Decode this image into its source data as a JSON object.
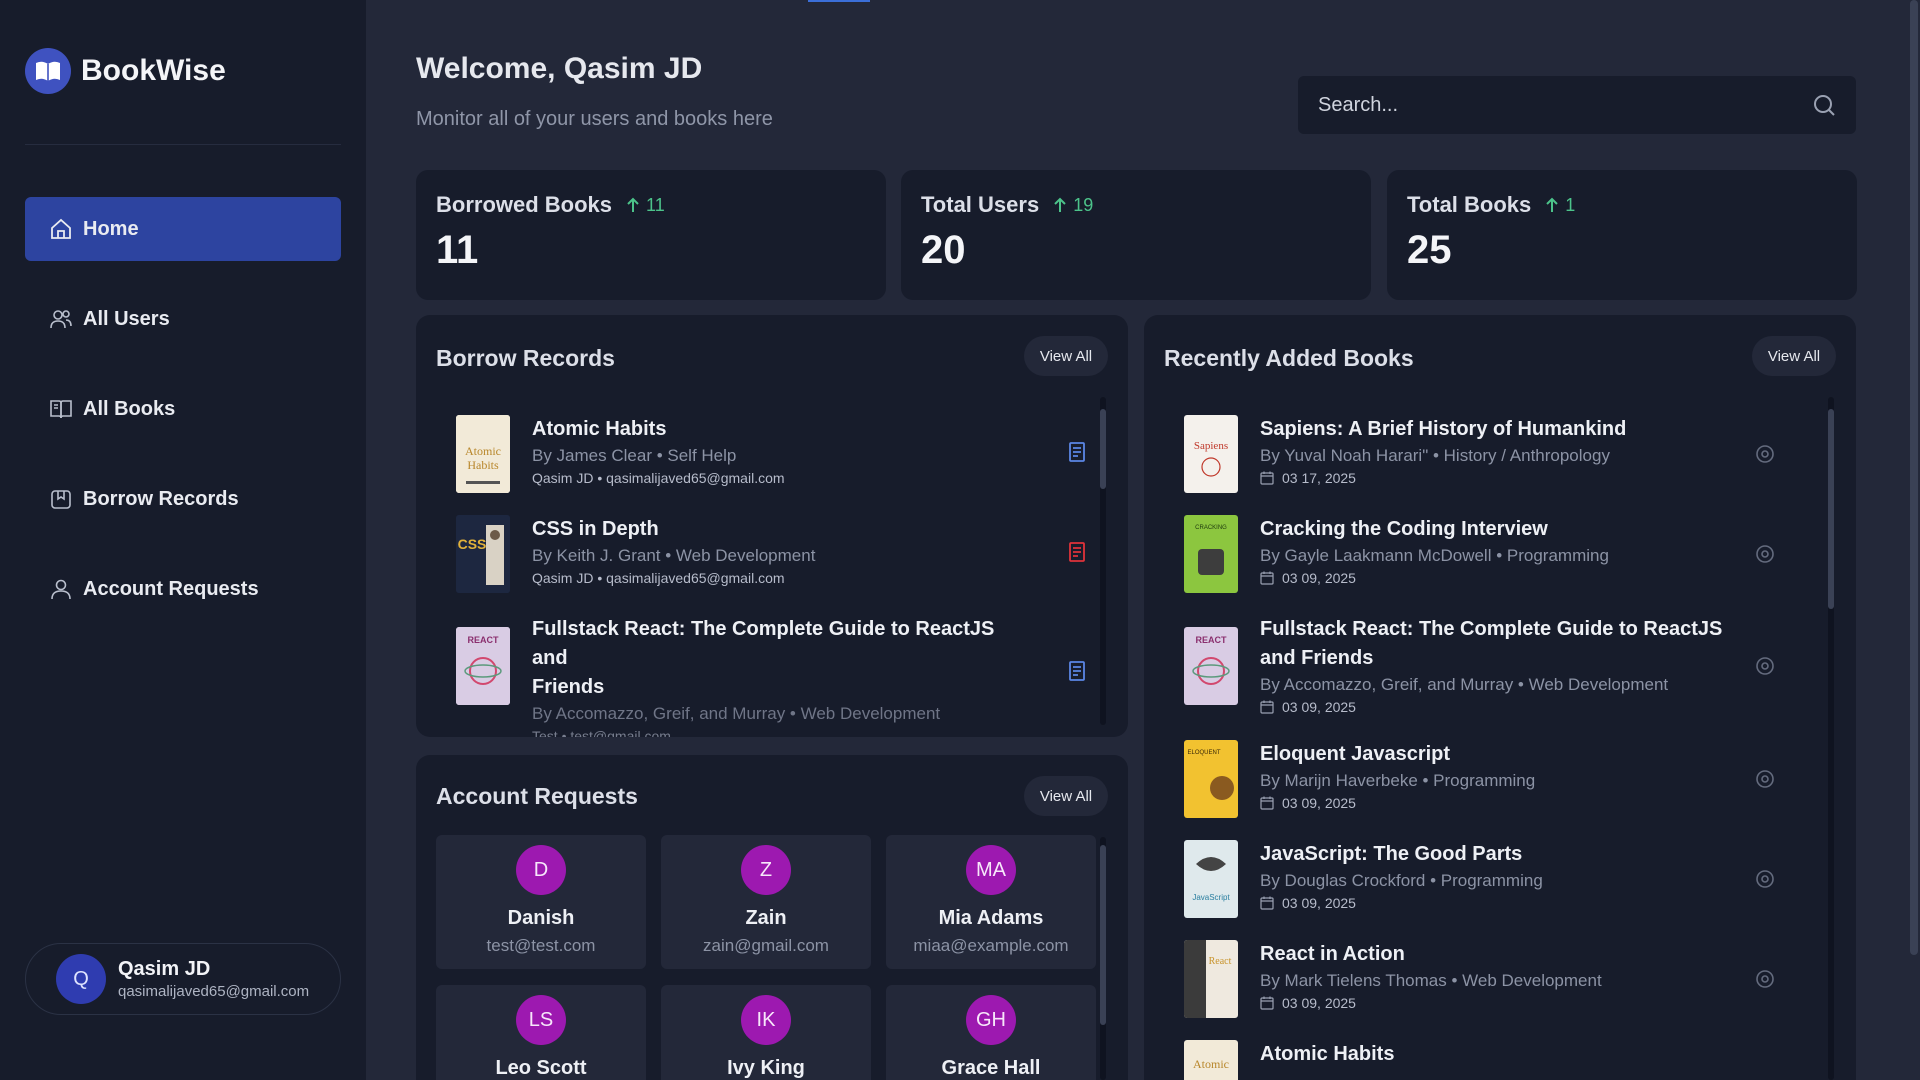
{
  "app": {
    "name": "BookWise"
  },
  "sidebar": {
    "items": [
      {
        "label": "Home",
        "icon": "home-icon",
        "active": true
      },
      {
        "label": "All Users",
        "icon": "users-icon"
      },
      {
        "label": "All Books",
        "icon": "book-open-icon"
      },
      {
        "label": "Borrow Records",
        "icon": "bookmark-icon"
      },
      {
        "label": "Account Requests",
        "icon": "user-icon"
      }
    ],
    "user": {
      "initial": "Q",
      "name": "Qasim JD",
      "email": "qasimalijaved65@gmail.com"
    }
  },
  "header": {
    "welcome": "Welcome, Qasim JD",
    "subtitle": "Monitor all of your users and books here",
    "search_placeholder": "Search..."
  },
  "stats": [
    {
      "title": "Borrowed Books",
      "change": "11",
      "value": "11"
    },
    {
      "title": "Total Users",
      "change": "19",
      "value": "20"
    },
    {
      "title": "Total Books",
      "change": "1",
      "value": "25"
    }
  ],
  "borrow_records": {
    "title": "Borrow Records",
    "view_all": "View All",
    "items": [
      {
        "title": "Atomic Habits",
        "meta": "By James Clear • Self Help",
        "user": "Qasim JD • qasimalijaved65@gmail.com",
        "cover_color": "#f2ead8",
        "status_color": "#5b86e5"
      },
      {
        "title": "CSS in Depth",
        "meta": "By Keith J. Grant • Web Development",
        "user": "Qasim JD • qasimalijaved65@gmail.com",
        "cover_color": "#1d2740",
        "status_color": "#e0323a"
      },
      {
        "title_line1": "Fullstack React: The Complete Guide to ReactJS and",
        "title_line2": "Friends",
        "meta": "By Accomazzo, Greif, and Murray • Web Development",
        "user": "Test • test@gmail.com",
        "cover_color": "#c8b8d8",
        "status_color": "#5b86e5"
      }
    ]
  },
  "account_requests": {
    "title": "Account Requests",
    "view_all": "View All",
    "items": [
      {
        "initials": "D",
        "name": "Danish",
        "email": "test@test.com"
      },
      {
        "initials": "Z",
        "name": "Zain",
        "email": "zain@gmail.com"
      },
      {
        "initials": "MA",
        "name": "Mia Adams",
        "email": "miaa@example.com"
      },
      {
        "initials": "LS",
        "name": "Leo Scott",
        "email": ""
      },
      {
        "initials": "IK",
        "name": "Ivy King",
        "email": ""
      },
      {
        "initials": "GH",
        "name": "Grace Hall",
        "email": ""
      }
    ]
  },
  "recent_books": {
    "title": "Recently Added Books",
    "view_all": "View All",
    "items": [
      {
        "title": "Sapiens: A Brief History of Humankind",
        "meta": "By Yuval Noah Harari\" • History / Anthropology",
        "date": "03 17, 2025",
        "cover_color": "#f4f1ec"
      },
      {
        "title": "Cracking the Coding Interview",
        "meta": "By Gayle Laakmann McDowell • Programming",
        "date": "03 09, 2025",
        "cover_color": "#8cc63f"
      },
      {
        "title_line1": "Fullstack React: The Complete Guide to ReactJS",
        "title_line2": "and Friends",
        "meta": "By Accomazzo, Greif, and Murray • Web Development",
        "date": "03 09, 2025",
        "cover_color": "#c8b8d8"
      },
      {
        "title": "Eloquent Javascript",
        "meta": "By Marijn Haverbeke • Programming",
        "date": "03 09, 2025",
        "cover_color": "#f2c230"
      },
      {
        "title": "JavaScript: The Good Parts",
        "meta": "By Douglas Crockford • Programming",
        "date": "03 09, 2025",
        "cover_color": "#dfe9ec"
      },
      {
        "title": "React in Action",
        "meta": "By Mark Tielens Thomas • Web Development",
        "date": "03 09, 2025",
        "cover_color": "#efe9df"
      },
      {
        "title": "Atomic Habits",
        "cover_color": "#f2ead8"
      }
    ]
  },
  "colors": {
    "sidebar_bg": "#171c2b",
    "main_bg": "#232839",
    "accent": "#2d44a0",
    "positive": "#4cc38a",
    "avatar_purple": "#9d19b0"
  }
}
